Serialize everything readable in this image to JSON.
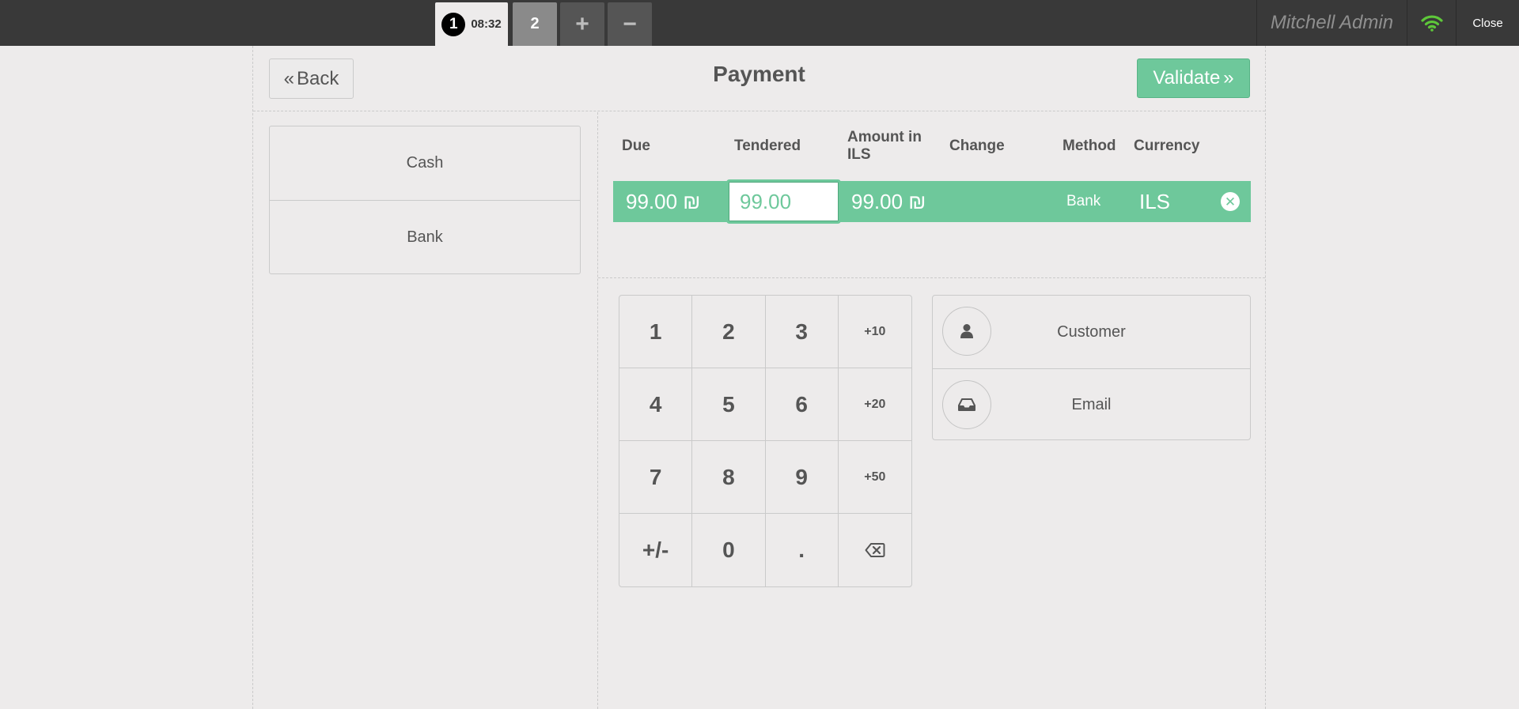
{
  "topbar": {
    "orders": [
      {
        "sequence": "1",
        "time": "08:32"
      },
      {
        "sequence": "2"
      }
    ],
    "add_order_icon": "+",
    "remove_order_icon": "−",
    "username": "Mitchell Admin",
    "close_label": "Close",
    "colors": {
      "bar": "#393939",
      "wifi": "#5ec83a"
    }
  },
  "header": {
    "back_label": "Back",
    "title": "Payment",
    "validate_label": "Validate"
  },
  "payment_methods": [
    "Cash",
    "Bank"
  ],
  "paymentlines": {
    "columns": {
      "due": "Due",
      "tendered": "Tendered",
      "amount": "Amount in ILS",
      "change": "Change",
      "method": "Method",
      "currency": "Currency"
    },
    "rows": [
      {
        "due": "99.00 ₪",
        "tendered": "99.00",
        "amount": "99.00 ₪",
        "change": "",
        "method": "Bank",
        "currency": "ILS"
      }
    ]
  },
  "numpad": {
    "keys": [
      "1",
      "2",
      "3",
      "+10",
      "4",
      "5",
      "6",
      "+20",
      "7",
      "8",
      "9",
      "+50",
      "+/-",
      "0",
      ".",
      "backspace-icon"
    ]
  },
  "extras": {
    "customer_label": "Customer",
    "email_label": "Email"
  },
  "accent_color": "#6ec89b"
}
